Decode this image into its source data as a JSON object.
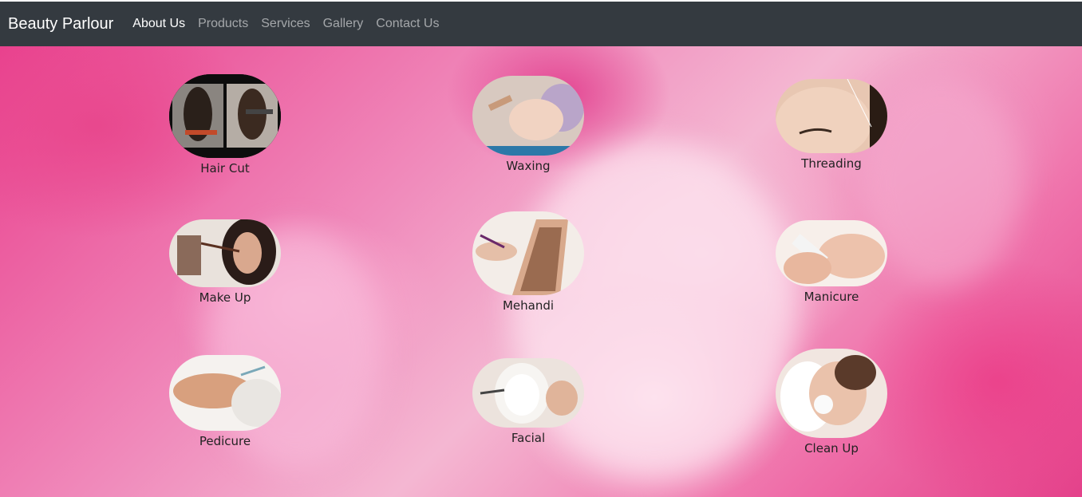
{
  "navbar": {
    "brand": "Beauty Parlour",
    "links": [
      {
        "label": "About Us",
        "active": true
      },
      {
        "label": "Products",
        "active": false
      },
      {
        "label": "Services",
        "active": false
      },
      {
        "label": "Gallery",
        "active": false
      },
      {
        "label": "Contact Us",
        "active": false
      }
    ]
  },
  "colors": {
    "navbar_bg": "#343a40",
    "hero_pink": "#e9418e",
    "hero_light_pink": "#f4b7d2"
  },
  "services": [
    {
      "label": "Hair Cut",
      "icon": "hair-cut-photo"
    },
    {
      "label": "Waxing",
      "icon": "waxing-photo"
    },
    {
      "label": "Threading",
      "icon": "threading-photo"
    },
    {
      "label": "Make Up",
      "icon": "make-up-photo"
    },
    {
      "label": "Mehandi",
      "icon": "mehandi-photo"
    },
    {
      "label": "Manicure",
      "icon": "manicure-photo"
    },
    {
      "label": "Pedicure",
      "icon": "pedicure-photo"
    },
    {
      "label": "Facial",
      "icon": "facial-photo"
    },
    {
      "label": "Clean Up",
      "icon": "clean-up-photo"
    }
  ]
}
